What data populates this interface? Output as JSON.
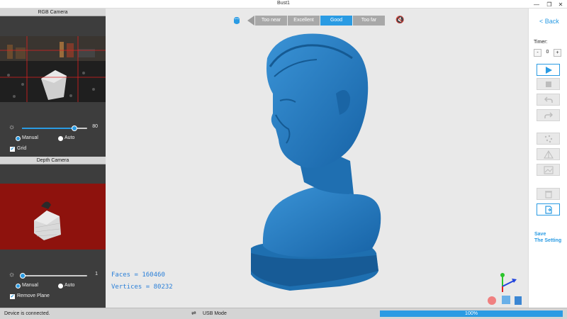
{
  "window": {
    "title": "Bust1",
    "minimize": "—",
    "restore": "❐",
    "close": "✕"
  },
  "rgb_camera": {
    "title": "RGB Camera",
    "brightness_value": "80",
    "brightness_level": 80,
    "mode_manual": "Manual",
    "mode_auto": "Auto",
    "grid_label": "Grid",
    "grid_checked": true
  },
  "depth_camera": {
    "title": "Depth Camera",
    "brightness_value": "1",
    "brightness_level": 1,
    "mode_manual": "Manual",
    "mode_auto": "Auto",
    "remove_plane_label": "Remove Plane",
    "remove_plane_checked": true
  },
  "distance_indicator": {
    "segments": [
      "Too near",
      "Excellent",
      "Good",
      "Too far"
    ],
    "active": "Good"
  },
  "stats": {
    "faces": "Faces = 160460",
    "vertices": "Vertices = 80232"
  },
  "right_panel": {
    "back": "< Back",
    "timer_label": "Timer:",
    "timer_minus": "-",
    "timer_value": "0",
    "timer_plus": "+",
    "save_setting": [
      "Save",
      "The Setting"
    ]
  },
  "status": {
    "connection": "Device is connected.",
    "usb_mode": "USB Mode",
    "progress": "100%",
    "progress_value": 100
  },
  "colors": {
    "accent": "#2a9be3",
    "model": "#1f78b4",
    "depth_bg": "#8e120d",
    "panel_bg": "#3d3d3d"
  }
}
